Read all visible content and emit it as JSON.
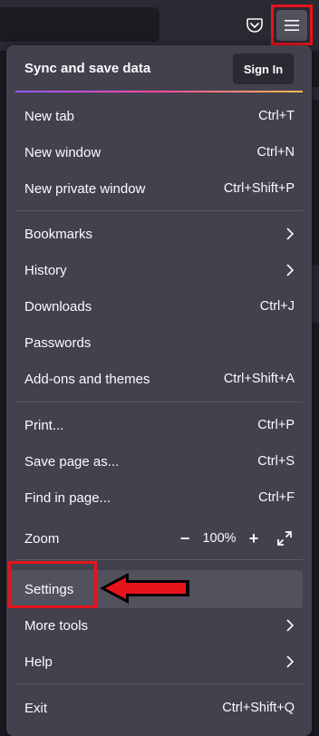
{
  "menu": {
    "sync": {
      "title": "Sync and save data",
      "sign_in": "Sign In"
    },
    "items": [
      {
        "label": "New tab",
        "shortcut": "Ctrl+T"
      },
      {
        "label": "New window",
        "shortcut": "Ctrl+N"
      },
      {
        "label": "New private window",
        "shortcut": "Ctrl+Shift+P"
      },
      {
        "label": "Bookmarks",
        "submenu": true
      },
      {
        "label": "History",
        "submenu": true
      },
      {
        "label": "Downloads",
        "shortcut": "Ctrl+J"
      },
      {
        "label": "Passwords"
      },
      {
        "label": "Add-ons and themes",
        "shortcut": "Ctrl+Shift+A"
      },
      {
        "label": "Print...",
        "shortcut": "Ctrl+P"
      },
      {
        "label": "Save page as...",
        "shortcut": "Ctrl+S"
      },
      {
        "label": "Find in page...",
        "shortcut": "Ctrl+F"
      },
      {
        "label": "Settings"
      },
      {
        "label": "More tools",
        "submenu": true
      },
      {
        "label": "Help",
        "submenu": true
      },
      {
        "label": "Exit",
        "shortcut": "Ctrl+Shift+Q"
      }
    ],
    "zoom": {
      "label": "Zoom",
      "value": "100%",
      "minus": "−",
      "plus": "+"
    }
  },
  "icons": {
    "toolbar": [
      "pocket-icon",
      "hamburger-menu-icon"
    ],
    "zoom_fullscreen": "fullscreen-icon",
    "submenu": "chevron-right-icon",
    "annotation": "red-arrow-left"
  },
  "colors": {
    "panel_bg": "#42414d",
    "toolbar_bg": "#2b2a33",
    "hover_bg": "#52525e",
    "highlight_red": "#e8141c"
  }
}
